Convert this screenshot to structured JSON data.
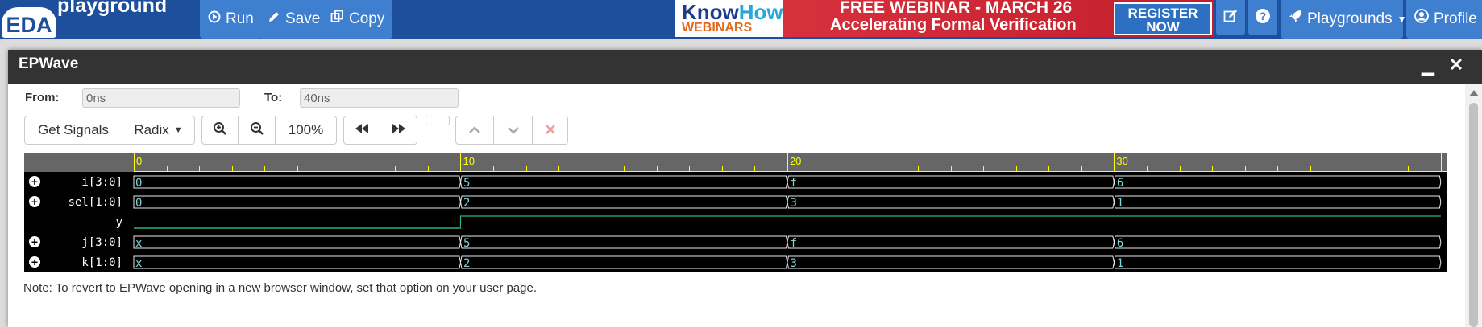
{
  "nav": {
    "logo_text": "EDA",
    "logo_sub": "playground",
    "run_label": "Run",
    "save_label": "Save",
    "copy_label": "Copy",
    "playgrounds_label": "Playgrounds",
    "profile_label": "Profile"
  },
  "ad": {
    "brand_part1": "Know",
    "brand_part2": "How",
    "brand_sub": "WEBINARS",
    "line1": "FREE WEBINAR - MARCH 26",
    "line2": "Accelerating Formal Verification",
    "register_line1": "REGISTER",
    "register_line2": "NOW"
  },
  "modal": {
    "title": "EPWave",
    "from_label": "From:",
    "from_value": "0ns",
    "to_label": "To:",
    "to_value": "40ns",
    "get_signals": "Get Signals",
    "radix": "Radix",
    "zoom_level": "100%",
    "note": "Note: To revert to EPWave opening in a new browser window, set that option on your user page."
  },
  "wave": {
    "time_end": 40,
    "ruler_labels": [
      "0",
      "10",
      "20",
      "30"
    ],
    "signals": [
      {
        "name": "i[3:0]",
        "expandable": true,
        "type": "bus",
        "segments": [
          {
            "start": 0,
            "end": 10,
            "value": "0"
          },
          {
            "start": 10,
            "end": 20,
            "value": "5"
          },
          {
            "start": 20,
            "end": 30,
            "value": "f"
          },
          {
            "start": 30,
            "end": 40,
            "value": "6"
          }
        ]
      },
      {
        "name": "sel[1:0]",
        "expandable": true,
        "type": "bus",
        "segments": [
          {
            "start": 0,
            "end": 10,
            "value": "0"
          },
          {
            "start": 10,
            "end": 20,
            "value": "2"
          },
          {
            "start": 20,
            "end": 30,
            "value": "3"
          },
          {
            "start": 30,
            "end": 40,
            "value": "1"
          }
        ]
      },
      {
        "name": "y",
        "expandable": false,
        "type": "bit",
        "transitions": [
          {
            "t": 0,
            "v": 0
          },
          {
            "t": 10,
            "v": 1
          }
        ]
      },
      {
        "name": "j[3:0]",
        "expandable": true,
        "type": "bus",
        "segments": [
          {
            "start": 0,
            "end": 10,
            "value": "x"
          },
          {
            "start": 10,
            "end": 20,
            "value": "5"
          },
          {
            "start": 20,
            "end": 30,
            "value": "f"
          },
          {
            "start": 30,
            "end": 40,
            "value": "6"
          }
        ]
      },
      {
        "name": "k[1:0]",
        "expandable": true,
        "type": "bus",
        "segments": [
          {
            "start": 0,
            "end": 10,
            "value": "x"
          },
          {
            "start": 10,
            "end": 20,
            "value": "2"
          },
          {
            "start": 20,
            "end": 30,
            "value": "3"
          },
          {
            "start": 30,
            "end": 40,
            "value": "1"
          }
        ]
      }
    ]
  },
  "colors": {
    "nav_bg": "#1d4f9c",
    "nav_btn": "#3f7fd0",
    "wave_bus": "#e8e8e8",
    "wave_bit": "#2bb673",
    "wave_bit_low": "#3fc7c7",
    "ruler_tick": "#ffff00"
  }
}
